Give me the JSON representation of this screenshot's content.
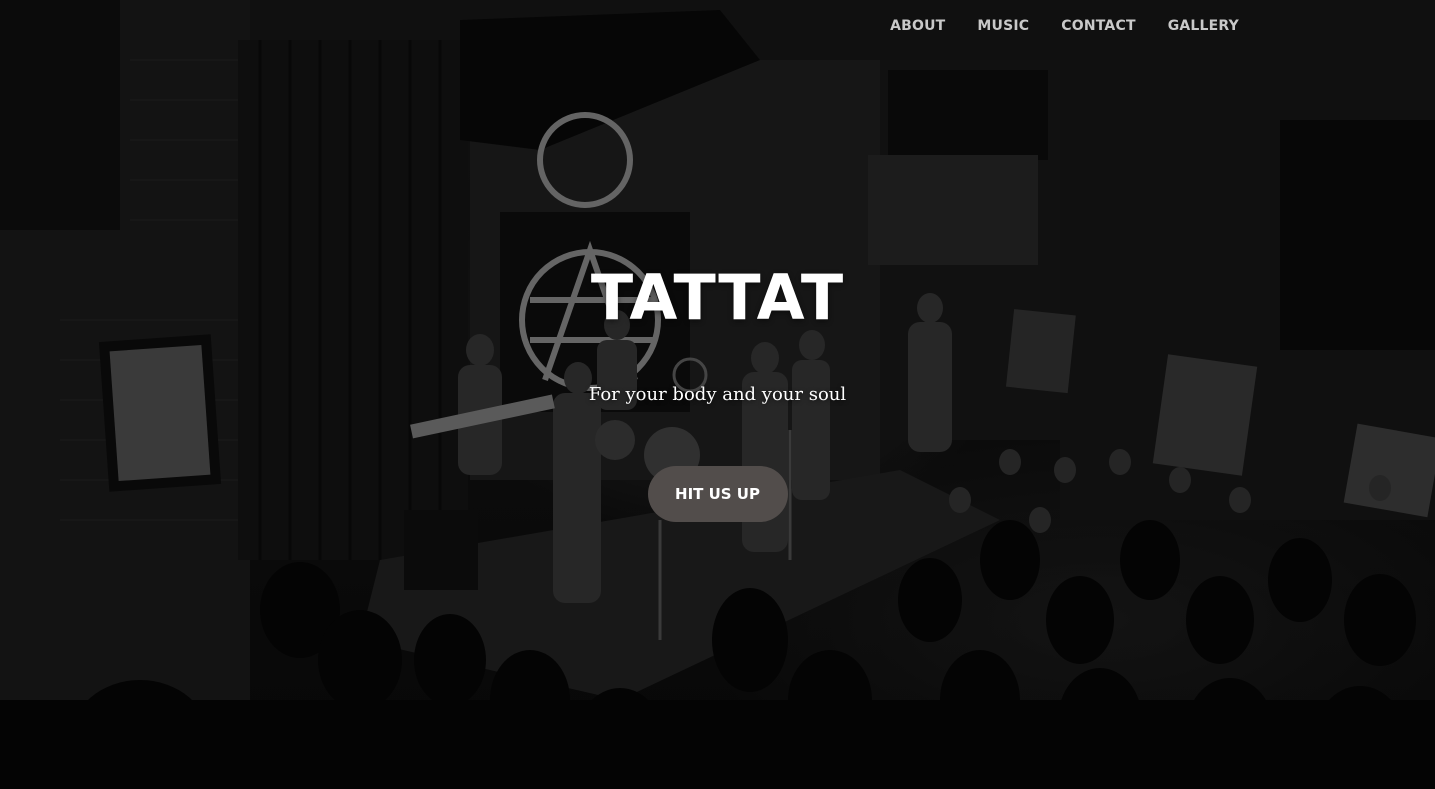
{
  "nav": {
    "items": [
      {
        "label": "ABOUT"
      },
      {
        "label": "MUSIC"
      },
      {
        "label": "CONTACT"
      },
      {
        "label": "GALLERY"
      }
    ]
  },
  "hero": {
    "title": "TATTAT",
    "subtitle": "For your body and your soul",
    "cta_label": "HIT US UP",
    "background_image": "black-and-white photo of a band performing on stage to a crowd"
  },
  "colors": {
    "nav_text": "#c9c9c9",
    "title_text": "#ffffff",
    "button_bg": "#524d4b",
    "button_text": "#ffffff"
  }
}
